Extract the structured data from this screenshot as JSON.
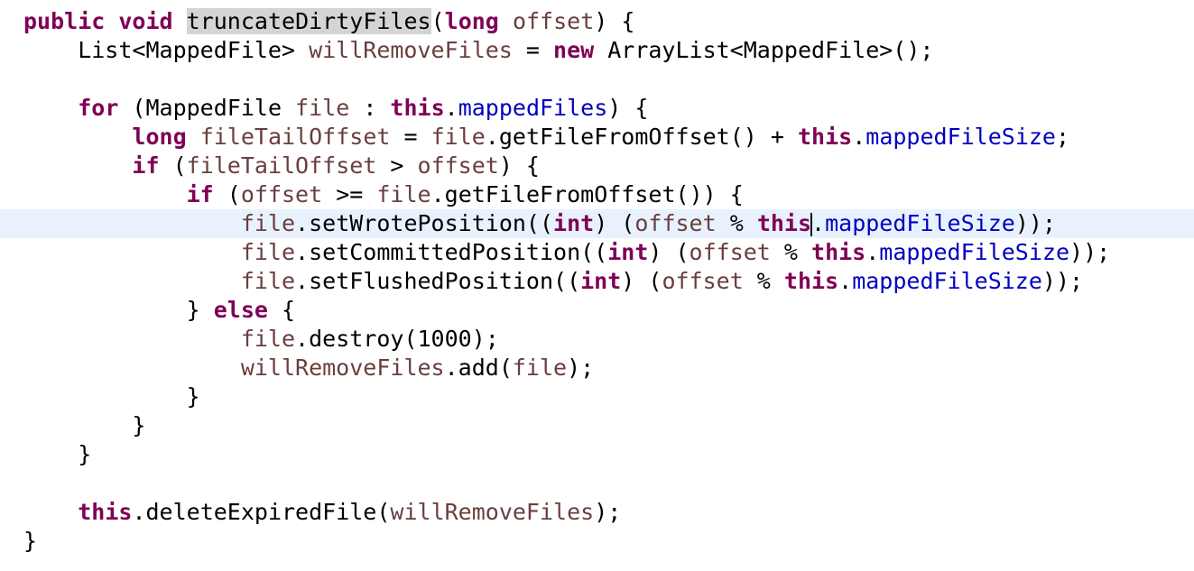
{
  "editor": {
    "lines": [
      {
        "tokens": [
          {
            "t": "kw",
            "v": "public"
          },
          {
            "t": "plain",
            "v": " "
          },
          {
            "t": "kw",
            "v": "void"
          },
          {
            "t": "plain",
            "v": " "
          },
          {
            "t": "hl",
            "v": "truncateDirtyFiles"
          },
          {
            "t": "plain",
            "v": "("
          },
          {
            "t": "kw",
            "v": "long"
          },
          {
            "t": "plain",
            "v": " "
          },
          {
            "t": "var",
            "v": "offset"
          },
          {
            "t": "plain",
            "v": ") {"
          }
        ]
      },
      {
        "tokens": [
          {
            "t": "plain",
            "v": "    List<MappedFile> "
          },
          {
            "t": "var",
            "v": "willRemoveFiles"
          },
          {
            "t": "plain",
            "v": " = "
          },
          {
            "t": "kw",
            "v": "new"
          },
          {
            "t": "plain",
            "v": " ArrayList<MappedFile>();"
          }
        ]
      },
      {
        "tokens": []
      },
      {
        "tokens": [
          {
            "t": "plain",
            "v": "    "
          },
          {
            "t": "kw",
            "v": "for"
          },
          {
            "t": "plain",
            "v": " (MappedFile "
          },
          {
            "t": "var",
            "v": "file"
          },
          {
            "t": "plain",
            "v": " : "
          },
          {
            "t": "kw",
            "v": "this"
          },
          {
            "t": "plain",
            "v": "."
          },
          {
            "t": "field",
            "v": "mappedFiles"
          },
          {
            "t": "plain",
            "v": ") {"
          }
        ]
      },
      {
        "tokens": [
          {
            "t": "plain",
            "v": "        "
          },
          {
            "t": "kw",
            "v": "long"
          },
          {
            "t": "plain",
            "v": " "
          },
          {
            "t": "var",
            "v": "fileTailOffset"
          },
          {
            "t": "plain",
            "v": " = "
          },
          {
            "t": "var",
            "v": "file"
          },
          {
            "t": "plain",
            "v": ".getFileFromOffset() + "
          },
          {
            "t": "kw",
            "v": "this"
          },
          {
            "t": "plain",
            "v": "."
          },
          {
            "t": "field",
            "v": "mappedFileSize"
          },
          {
            "t": "plain",
            "v": ";"
          }
        ]
      },
      {
        "tokens": [
          {
            "t": "plain",
            "v": "        "
          },
          {
            "t": "kw",
            "v": "if"
          },
          {
            "t": "plain",
            "v": " ("
          },
          {
            "t": "var",
            "v": "fileTailOffset"
          },
          {
            "t": "plain",
            "v": " > "
          },
          {
            "t": "var",
            "v": "offset"
          },
          {
            "t": "plain",
            "v": ") {"
          }
        ]
      },
      {
        "tokens": [
          {
            "t": "plain",
            "v": "            "
          },
          {
            "t": "kw",
            "v": "if"
          },
          {
            "t": "plain",
            "v": " ("
          },
          {
            "t": "var",
            "v": "offset"
          },
          {
            "t": "plain",
            "v": " >= "
          },
          {
            "t": "var",
            "v": "file"
          },
          {
            "t": "plain",
            "v": ".getFileFromOffset()) {"
          }
        ]
      },
      {
        "current": true,
        "tokens": [
          {
            "t": "plain",
            "v": "                "
          },
          {
            "t": "var",
            "v": "file"
          },
          {
            "t": "plain",
            "v": ".setWrotePosition(("
          },
          {
            "t": "kw",
            "v": "int"
          },
          {
            "t": "plain",
            "v": ") ("
          },
          {
            "t": "var",
            "v": "offset"
          },
          {
            "t": "plain",
            "v": " % "
          },
          {
            "t": "kw",
            "v": "this"
          },
          {
            "t": "caret",
            "v": ""
          },
          {
            "t": "plain",
            "v": "."
          },
          {
            "t": "field",
            "v": "mappedFileSize"
          },
          {
            "t": "plain",
            "v": "));"
          }
        ]
      },
      {
        "tokens": [
          {
            "t": "plain",
            "v": "                "
          },
          {
            "t": "var",
            "v": "file"
          },
          {
            "t": "plain",
            "v": ".setCommittedPosition(("
          },
          {
            "t": "kw",
            "v": "int"
          },
          {
            "t": "plain",
            "v": ") ("
          },
          {
            "t": "var",
            "v": "offset"
          },
          {
            "t": "plain",
            "v": " % "
          },
          {
            "t": "kw",
            "v": "this"
          },
          {
            "t": "plain",
            "v": "."
          },
          {
            "t": "field",
            "v": "mappedFileSize"
          },
          {
            "t": "plain",
            "v": "));"
          }
        ]
      },
      {
        "tokens": [
          {
            "t": "plain",
            "v": "                "
          },
          {
            "t": "var",
            "v": "file"
          },
          {
            "t": "plain",
            "v": ".setFlushedPosition(("
          },
          {
            "t": "kw",
            "v": "int"
          },
          {
            "t": "plain",
            "v": ") ("
          },
          {
            "t": "var",
            "v": "offset"
          },
          {
            "t": "plain",
            "v": " % "
          },
          {
            "t": "kw",
            "v": "this"
          },
          {
            "t": "plain",
            "v": "."
          },
          {
            "t": "field",
            "v": "mappedFileSize"
          },
          {
            "t": "plain",
            "v": "));"
          }
        ]
      },
      {
        "tokens": [
          {
            "t": "plain",
            "v": "            } "
          },
          {
            "t": "kw",
            "v": "else"
          },
          {
            "t": "plain",
            "v": " {"
          }
        ]
      },
      {
        "tokens": [
          {
            "t": "plain",
            "v": "                "
          },
          {
            "t": "var",
            "v": "file"
          },
          {
            "t": "plain",
            "v": ".destroy(1000);"
          }
        ]
      },
      {
        "tokens": [
          {
            "t": "plain",
            "v": "                "
          },
          {
            "t": "var",
            "v": "willRemoveFiles"
          },
          {
            "t": "plain",
            "v": ".add("
          },
          {
            "t": "var",
            "v": "file"
          },
          {
            "t": "plain",
            "v": ");"
          }
        ]
      },
      {
        "tokens": [
          {
            "t": "plain",
            "v": "            }"
          }
        ]
      },
      {
        "tokens": [
          {
            "t": "plain",
            "v": "        }"
          }
        ]
      },
      {
        "tokens": [
          {
            "t": "plain",
            "v": "    }"
          }
        ]
      },
      {
        "tokens": []
      },
      {
        "tokens": [
          {
            "t": "plain",
            "v": "    "
          },
          {
            "t": "kw",
            "v": "this"
          },
          {
            "t": "plain",
            "v": ".deleteExpiredFile("
          },
          {
            "t": "var",
            "v": "willRemoveFiles"
          },
          {
            "t": "plain",
            "v": ");"
          }
        ]
      },
      {
        "tokens": [
          {
            "t": "plain",
            "v": "}"
          }
        ]
      }
    ],
    "colors": {
      "keyword": "#7f0055",
      "variable": "#6a3e3e",
      "field": "#0000c0",
      "current_line": "#e8f2fe",
      "selection_highlight": "#d4d4d4"
    }
  }
}
